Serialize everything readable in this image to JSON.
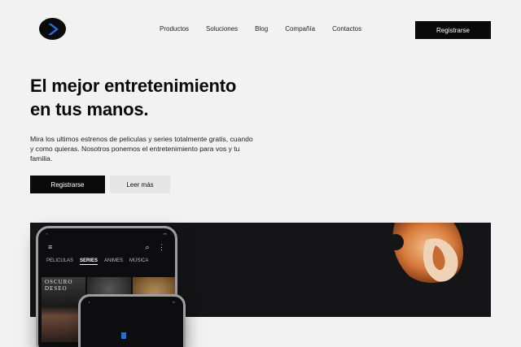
{
  "nav": {
    "items": [
      "Productos",
      "Soluciones",
      "Blog",
      "Compañía",
      "Contactos"
    ],
    "register_label": "Registrarse"
  },
  "hero": {
    "title_line1": "El mejor entretenimiento",
    "title_line2": "en tus manos.",
    "subtitle": "Mira los ultimos estrenos de peliculas y series totalmente gratis, cuando y como quieras. Nosotros ponemos el entretenimiento para vos y tu familia.",
    "primary_cta": "Registrarse",
    "secondary_cta": "Leer más"
  },
  "phone_app": {
    "tabs": [
      "PELICULAS",
      "SERIES",
      "ANIMES",
      "MÚSICA"
    ],
    "active_tab": "SERIES",
    "thumb_title": "OSCURO DESEO"
  },
  "colors": {
    "brand_blue": "#1e6fe0",
    "dark": "#0a0a0a",
    "banner": "#151517",
    "flame": "#e08a4a"
  }
}
